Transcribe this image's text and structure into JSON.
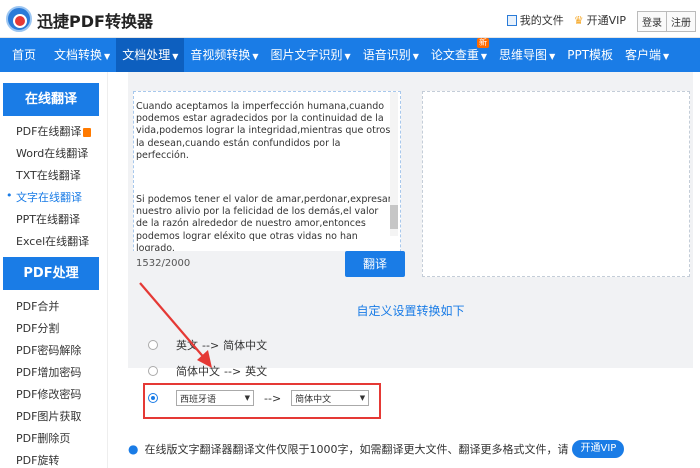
{
  "app": {
    "title": "迅捷PDF转换器"
  },
  "top_links": {
    "my_files": "我的文件",
    "vip": "开通VIP"
  },
  "auth": {
    "login": "登录",
    "register": "注册"
  },
  "nav": {
    "items": [
      {
        "label": "首页",
        "caret": false
      },
      {
        "label": "文档转换",
        "caret": true
      },
      {
        "label": "文档处理",
        "caret": true
      },
      {
        "label": "音视频转换",
        "caret": true
      },
      {
        "label": "图片文字识别",
        "caret": true
      },
      {
        "label": "语音识别",
        "caret": true
      },
      {
        "label": "论文查重",
        "caret": true
      },
      {
        "label": "思维导图",
        "caret": true
      },
      {
        "label": "PPT模板",
        "caret": false
      },
      {
        "label": "客户端",
        "caret": true
      }
    ],
    "new_badge": "新"
  },
  "sidebar": {
    "section1": "在线翻译",
    "items1": [
      "PDF在线翻译",
      "Word在线翻译",
      "TXT在线翻译",
      "文字在线翻译",
      "PPT在线翻译",
      "Excel在线翻译"
    ],
    "section2": "PDF处理",
    "items2": [
      "PDF合并",
      "PDF分割",
      "PDF密码解除",
      "PDF增加密码",
      "PDF修改密码",
      "PDF图片获取",
      "PDF删除页",
      "PDF旋转"
    ]
  },
  "source": {
    "text_p1": "Cuando aceptamos la imperfección humana,cuando podemos estar agradecidos por la continuidad de la vida,podemos lograr la integridad,mientras que otros la desean,cuando están confundidos por la perfección.",
    "text_p2": "Si podemos tener el valor de amar,perdonar,expresar nuestro alivio por la felicidad de los demás,el valor de la razón alrededor de nuestro amor,entonces podemos lograr eléxito que otras vidas no han logrado.",
    "counter": "1532/2000",
    "translate_button": "翻译"
  },
  "settings": {
    "title": "自定义设置转换如下",
    "opt1": {
      "from": "英文",
      "arrow": "-->",
      "to": "简体中文"
    },
    "opt2": {
      "from": "简体中文",
      "arrow": "-->",
      "to": "英文"
    },
    "opt3": {
      "from_select": "西班牙语",
      "arrow": "-->",
      "to_select": "简体中文"
    }
  },
  "note": {
    "text": "在线版文字翻译器翻译文件仅限于1000字，如需翻译更大文件、翻译更多格式文件，请",
    "vip_button": "开通VIP"
  },
  "colors": {
    "primary": "#1a7ce6",
    "nav_active": "#0d5fbf",
    "annotation_red": "#e53935"
  }
}
